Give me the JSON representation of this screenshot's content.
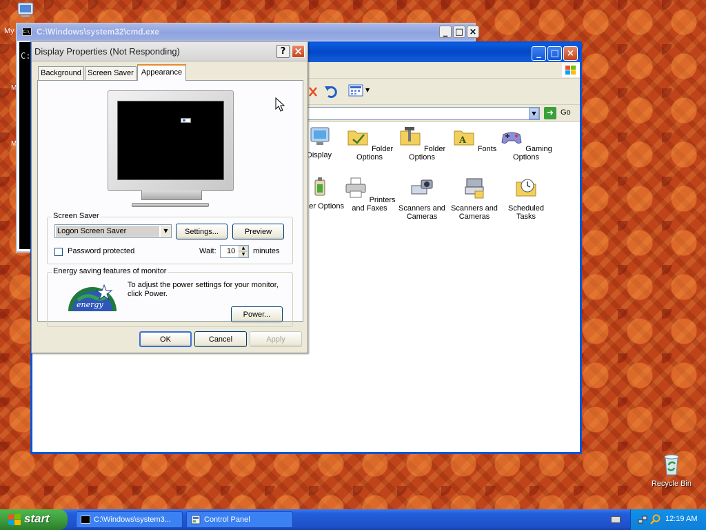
{
  "desktop": {
    "my_computer_fragment": "My",
    "left_fragments": [
      "M",
      "M"
    ],
    "recycle_bin": "Recycle Bin"
  },
  "cmd_window": {
    "title": "C:\\Windows\\system32\\cmd.exe",
    "prompt_fragment": "C:",
    "min": "_",
    "max": "□",
    "close": "×"
  },
  "control_panel": {
    "min": "_",
    "max": "□",
    "close": "×",
    "go_label": "Go",
    "icons": [
      {
        "label": "Display",
        "icon": "display-icon"
      },
      {
        "label": "Folder Options",
        "icon": "folder-options-icon"
      },
      {
        "label": "Folder Options",
        "icon": "folder-options-tools-icon"
      },
      {
        "label": "Fonts",
        "icon": "fonts-folder-icon"
      },
      {
        "label": "Gaming Options",
        "icon": "gamepad-icon"
      },
      {
        "label": "er Options",
        "icon": "power-options-icon"
      },
      {
        "label": "Printers and Faxes",
        "icon": "printer-icon"
      },
      {
        "label": "Scanners and Cameras",
        "icon": "scanner-camera-icon"
      },
      {
        "label": "Scanners and Cameras",
        "icon": "scanner-icon"
      },
      {
        "label": "Scheduled Tasks",
        "icon": "scheduled-tasks-icon"
      }
    ]
  },
  "dialog": {
    "title": "Display Properties (Not Responding)",
    "help": "?",
    "close": "×",
    "tabs": [
      "Background",
      "Screen Saver",
      "Appearance"
    ],
    "active_tab": "Appearance",
    "screen_saver_group": "Screen Saver",
    "screen_saver_value": "Logon Screen Saver",
    "settings_button": "Settings...",
    "preview_button": "Preview",
    "password_label": "Password protected",
    "password_checked": false,
    "wait_label": "Wait:",
    "wait_value": "10",
    "minutes_label": "minutes",
    "energy_group": "Energy saving features of monitor",
    "energy_text": "To adjust the power settings for your monitor, click Power.",
    "power_button": "Power...",
    "ok_button": "OK",
    "cancel_button": "Cancel",
    "apply_button": "Apply",
    "energy_logo_text": "energy"
  },
  "taskbar": {
    "start_label": "start",
    "tasks": [
      {
        "label": "C:\\Windows\\system3...",
        "icon": "cmd-icon"
      },
      {
        "label": "Control Panel",
        "icon": "control-panel-icon"
      }
    ],
    "clock": "12:19 AM"
  },
  "colors": {
    "xp_blue": "#0347c8",
    "taskbar": "#245edb",
    "start_green": "#3c9a3c",
    "dialog_bg": "#ece9d8"
  }
}
